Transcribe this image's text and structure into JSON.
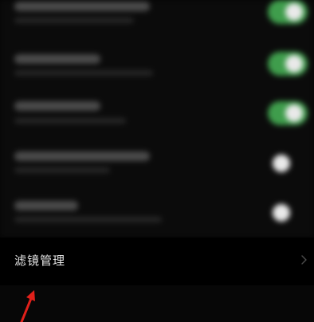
{
  "settings": {
    "rows": [
      {
        "state": "on"
      },
      {
        "state": "on"
      },
      {
        "state": "on"
      },
      {
        "state": "off"
      },
      {
        "state": "off"
      }
    ]
  },
  "filter_management": {
    "label": "滤镜管理",
    "icon": "chevron-right-icon"
  },
  "annotation": {
    "icon": "red-arrow-icon",
    "color": "#e0201a"
  },
  "colors": {
    "toggle_on": "#3f9d4c",
    "background": "#000000",
    "label_text": "#e6e6e6"
  }
}
